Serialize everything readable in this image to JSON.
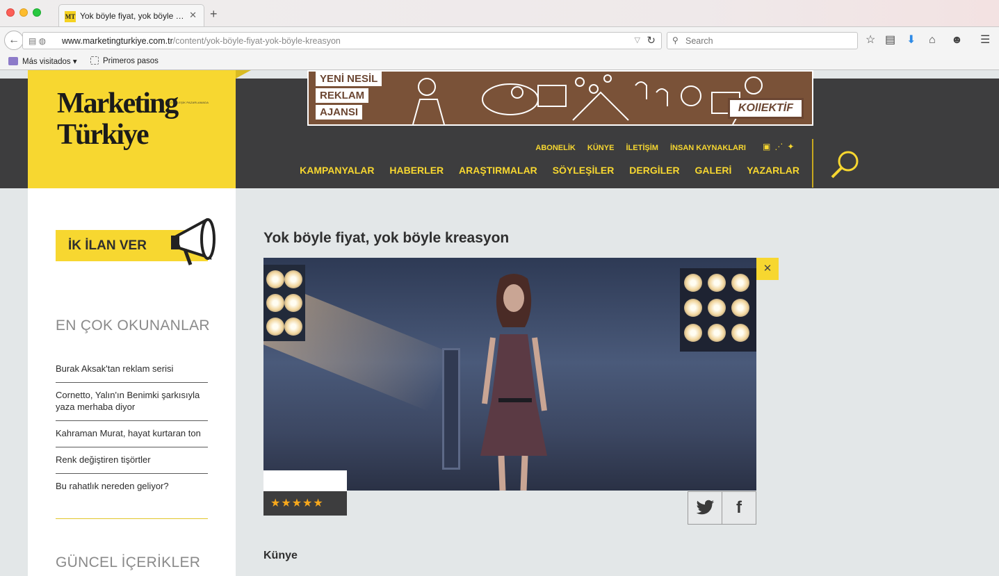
{
  "browser": {
    "tab_title": "Yok böyle fiyat, yok böyle kr...",
    "tab_favicon": "MT",
    "url_host": "www.marketingturkiye.com.tr",
    "url_path": "/content/yok-böyle-fiyat-yok-böyle-kreasyon",
    "search_placeholder": "Search",
    "bookmarks": [
      "Más visitados",
      "Primeros pasos"
    ]
  },
  "logo": {
    "line1": "Marketing",
    "line2": "Türkiye",
    "tagline": "BÜTÜNLEŞİK PAZARLAMADA"
  },
  "ad": {
    "lines": [
      "YENİ NESİL",
      "REKLAM",
      "AJANSI"
    ],
    "brand": "KOllEKTİF"
  },
  "topnav": [
    "ABONELİK",
    "KÜNYE",
    "İLETİŞİM",
    "İNSAN KAYNAKLARI"
  ],
  "mainnav": [
    "KAMPANYALAR",
    "HABERLER",
    "ARAŞTIRMALAR",
    "SÖYLEŞİLER",
    "DERGİLER",
    "GALERİ",
    "YAZARLAR"
  ],
  "sidebar": {
    "ik_button": "İK İLAN VER",
    "most_read_title": "EN ÇOK OKUNANLAR",
    "most_read": [
      "Burak Aksak'tan reklam serisi",
      "Cornetto, Yalın'ın Benimki şarkısıyla yaza merhaba diyor",
      "Kahraman Murat, hayat kurtaran ton",
      "Renk değiştiren tişörtler",
      "Bu rahatlık nereden geliyor?"
    ],
    "current_title": "GÜNCEL İÇERİKLER"
  },
  "article": {
    "title": "Yok böyle fiyat, yok böyle kreasyon",
    "rating_stars": 5,
    "close_glyph": "✕",
    "share": {
      "twitter": "🐦",
      "facebook": "f"
    },
    "kunye_label": "Künye"
  },
  "colors": {
    "brand_yellow": "#f7d730",
    "header_dark": "#3d3d3e",
    "page_bg": "#e3e7e8",
    "star": "#f7a81c"
  }
}
